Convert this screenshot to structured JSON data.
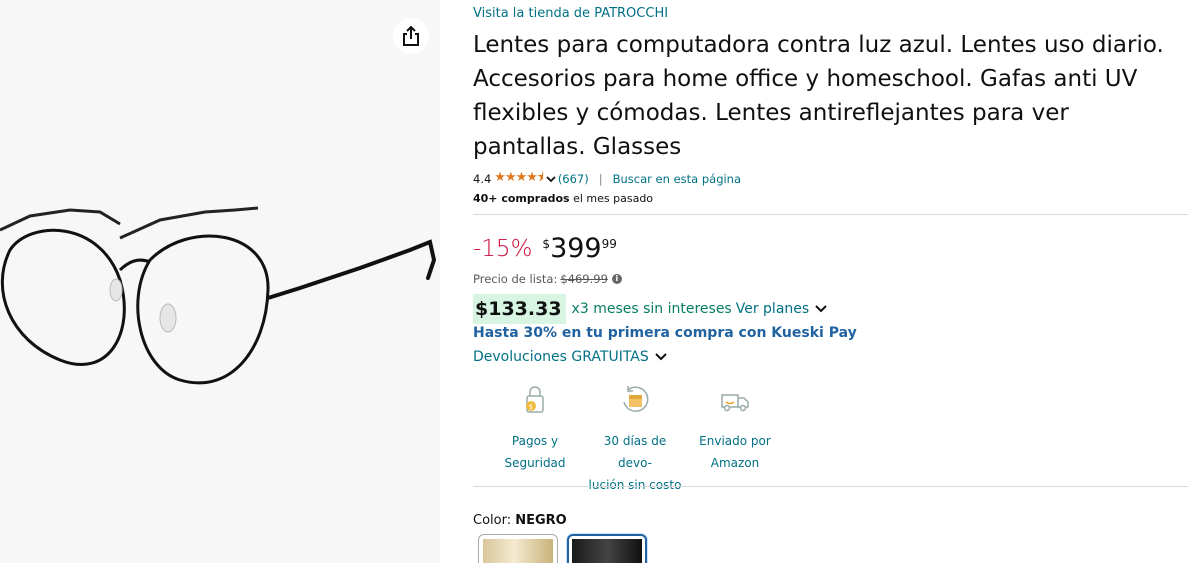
{
  "store": {
    "link": "Visita la tienda de PATROCCHI"
  },
  "product": {
    "title": "Lentes para computadora contra luz azul. Lentes uso diario. Accesorios para home office y homeschool. Gafas anti UV flexibles y cómodas. Lentes antireflejantes para ver pantallas. Glasses"
  },
  "rating": {
    "value": "4.4",
    "stars": "★★★★⯨",
    "count": "(667)",
    "separator": "|",
    "search_page": "Buscar en esta página"
  },
  "bought": {
    "bold": "40+ comprados",
    "rest": " el mes pasado"
  },
  "price": {
    "discount": "-15%",
    "currency": "$",
    "whole": "399",
    "fraction": "99",
    "list_label": "Precio de lista:",
    "list_value": "$469.99",
    "info_glyph": "i"
  },
  "installment": {
    "amount": "$133.33",
    "text": "x3 meses sin intereses",
    "link": "Ver planes"
  },
  "kueski": {
    "text": "Hasta 30% en tu primera compra con Kueski Pay"
  },
  "returns": {
    "text": "Devoluciones GRATUITAS"
  },
  "features": [
    {
      "line1": "Pagos y",
      "line2": "Seguridad",
      "icon": "secure-payment-icon"
    },
    {
      "line1": "30 días de devo-",
      "line2": "lución sin costo",
      "icon": "return-icon"
    },
    {
      "line1": "Enviado por",
      "line2": "Amazon",
      "icon": "delivery-truck-icon"
    }
  ],
  "color": {
    "label": "Color: ",
    "value": "NEGRO"
  },
  "colors": {
    "accent_link": "#007185",
    "price_discount": "#cc0c39",
    "stars": "#de7921",
    "installment_bg": "#d8f5e3",
    "kueski": "#2162a1"
  }
}
